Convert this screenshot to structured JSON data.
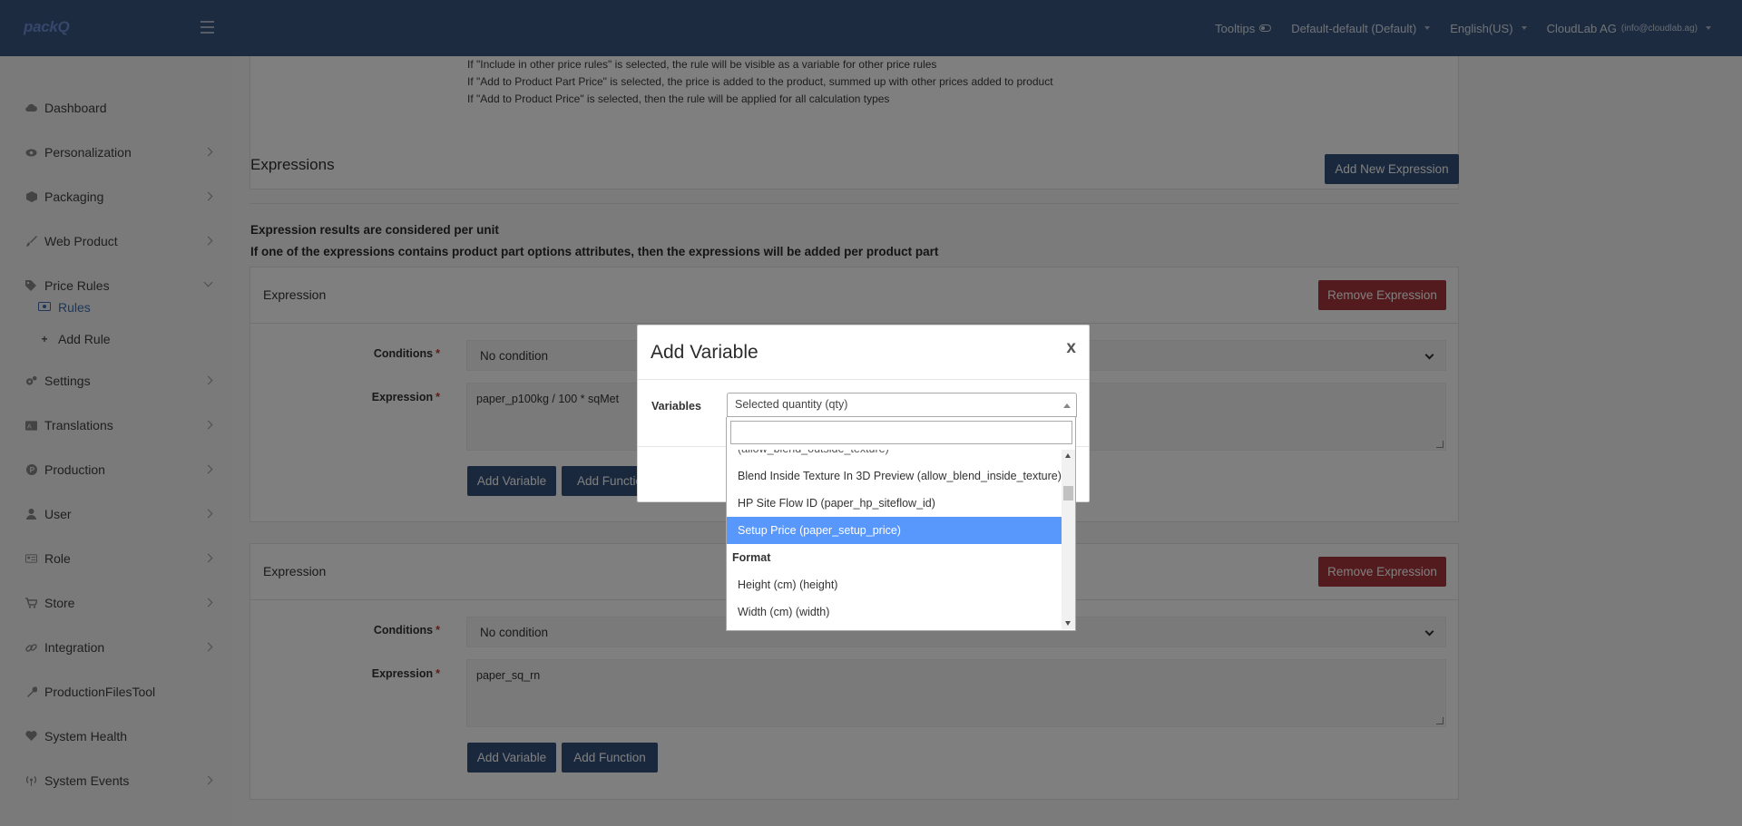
{
  "topbar": {
    "logo": "packQ",
    "tooltips_label": "Tooltips",
    "store_selector": "Default-default (Default)",
    "language": "English(US)",
    "user_name": "CloudLab AG",
    "user_email": "(info@cloudlab.ag)"
  },
  "sidebar": {
    "items": [
      {
        "label": "Dashboard"
      },
      {
        "label": "Personalization"
      },
      {
        "label": "Packaging"
      },
      {
        "label": "Web Product"
      },
      {
        "label": "Price Rules"
      },
      {
        "label": "Settings"
      },
      {
        "label": "Translations"
      },
      {
        "label": "Production"
      },
      {
        "label": "User"
      },
      {
        "label": "Role"
      },
      {
        "label": "Store"
      },
      {
        "label": "Integration"
      },
      {
        "label": "ProductionFilesTool"
      },
      {
        "label": "System Health"
      },
      {
        "label": "System Events"
      }
    ],
    "sub_items": [
      {
        "label": "Rules"
      },
      {
        "label": "Add Rule"
      }
    ]
  },
  "info_lines": [
    "If \"Include in other price rules\" is selected, the rule will be visible as a variable for other price rules",
    "If \"Add to Product Part Price\" is selected, the price is added to the product, summed up with other prices added to product",
    "If \"Add to Product Price\" is selected, then the rule will be applied for all calculation types"
  ],
  "expressions": {
    "title": "Expressions",
    "add_button": "Add New Expression",
    "note1": "Expression results are considered per unit",
    "note2": "If one of the expressions contains product part options attributes, then the expressions will be added per product part",
    "items": [
      {
        "title": "Expression",
        "remove_label": "Remove Expression",
        "conditions_label": "Conditions",
        "conditions_value": "No condition",
        "expression_label": "Expression",
        "expression_value": "paper_p100kg / 100 * sqMet",
        "add_variable": "Add Variable",
        "add_function": "Add Functio"
      },
      {
        "title": "Expression",
        "remove_label": "Remove Expression",
        "conditions_label": "Conditions",
        "conditions_value": "No condition",
        "expression_label": "Expression",
        "expression_value": "paper_sq_rn",
        "add_variable": "Add Variable",
        "add_function": "Add Function"
      }
    ],
    "required_mark": "*"
  },
  "modal": {
    "title": "Add Variable",
    "close": "x",
    "variables_label": "Variables",
    "selected_value": "Selected quantity (qty)",
    "search_value": "",
    "options": [
      {
        "type": "option",
        "label": "(allow_blend_outside_texture)"
      },
      {
        "type": "option",
        "label": "Blend Inside Texture In 3D Preview (allow_blend_inside_texture)"
      },
      {
        "type": "option",
        "label": "HP Site Flow ID (paper_hp_siteflow_id)"
      },
      {
        "type": "option",
        "label": "Setup Price (paper_setup_price)",
        "highlighted": true
      },
      {
        "type": "group",
        "label": "Format"
      },
      {
        "type": "option",
        "label": "Height (cm) (height)"
      },
      {
        "type": "option",
        "label": "Width (cm) (width)"
      }
    ]
  },
  "colors": {
    "topbar": "#38567f",
    "primary_button": "#35507b",
    "danger_button": "#a9373d",
    "highlight": "#5897fb",
    "active_link": "#3f6fb5"
  }
}
